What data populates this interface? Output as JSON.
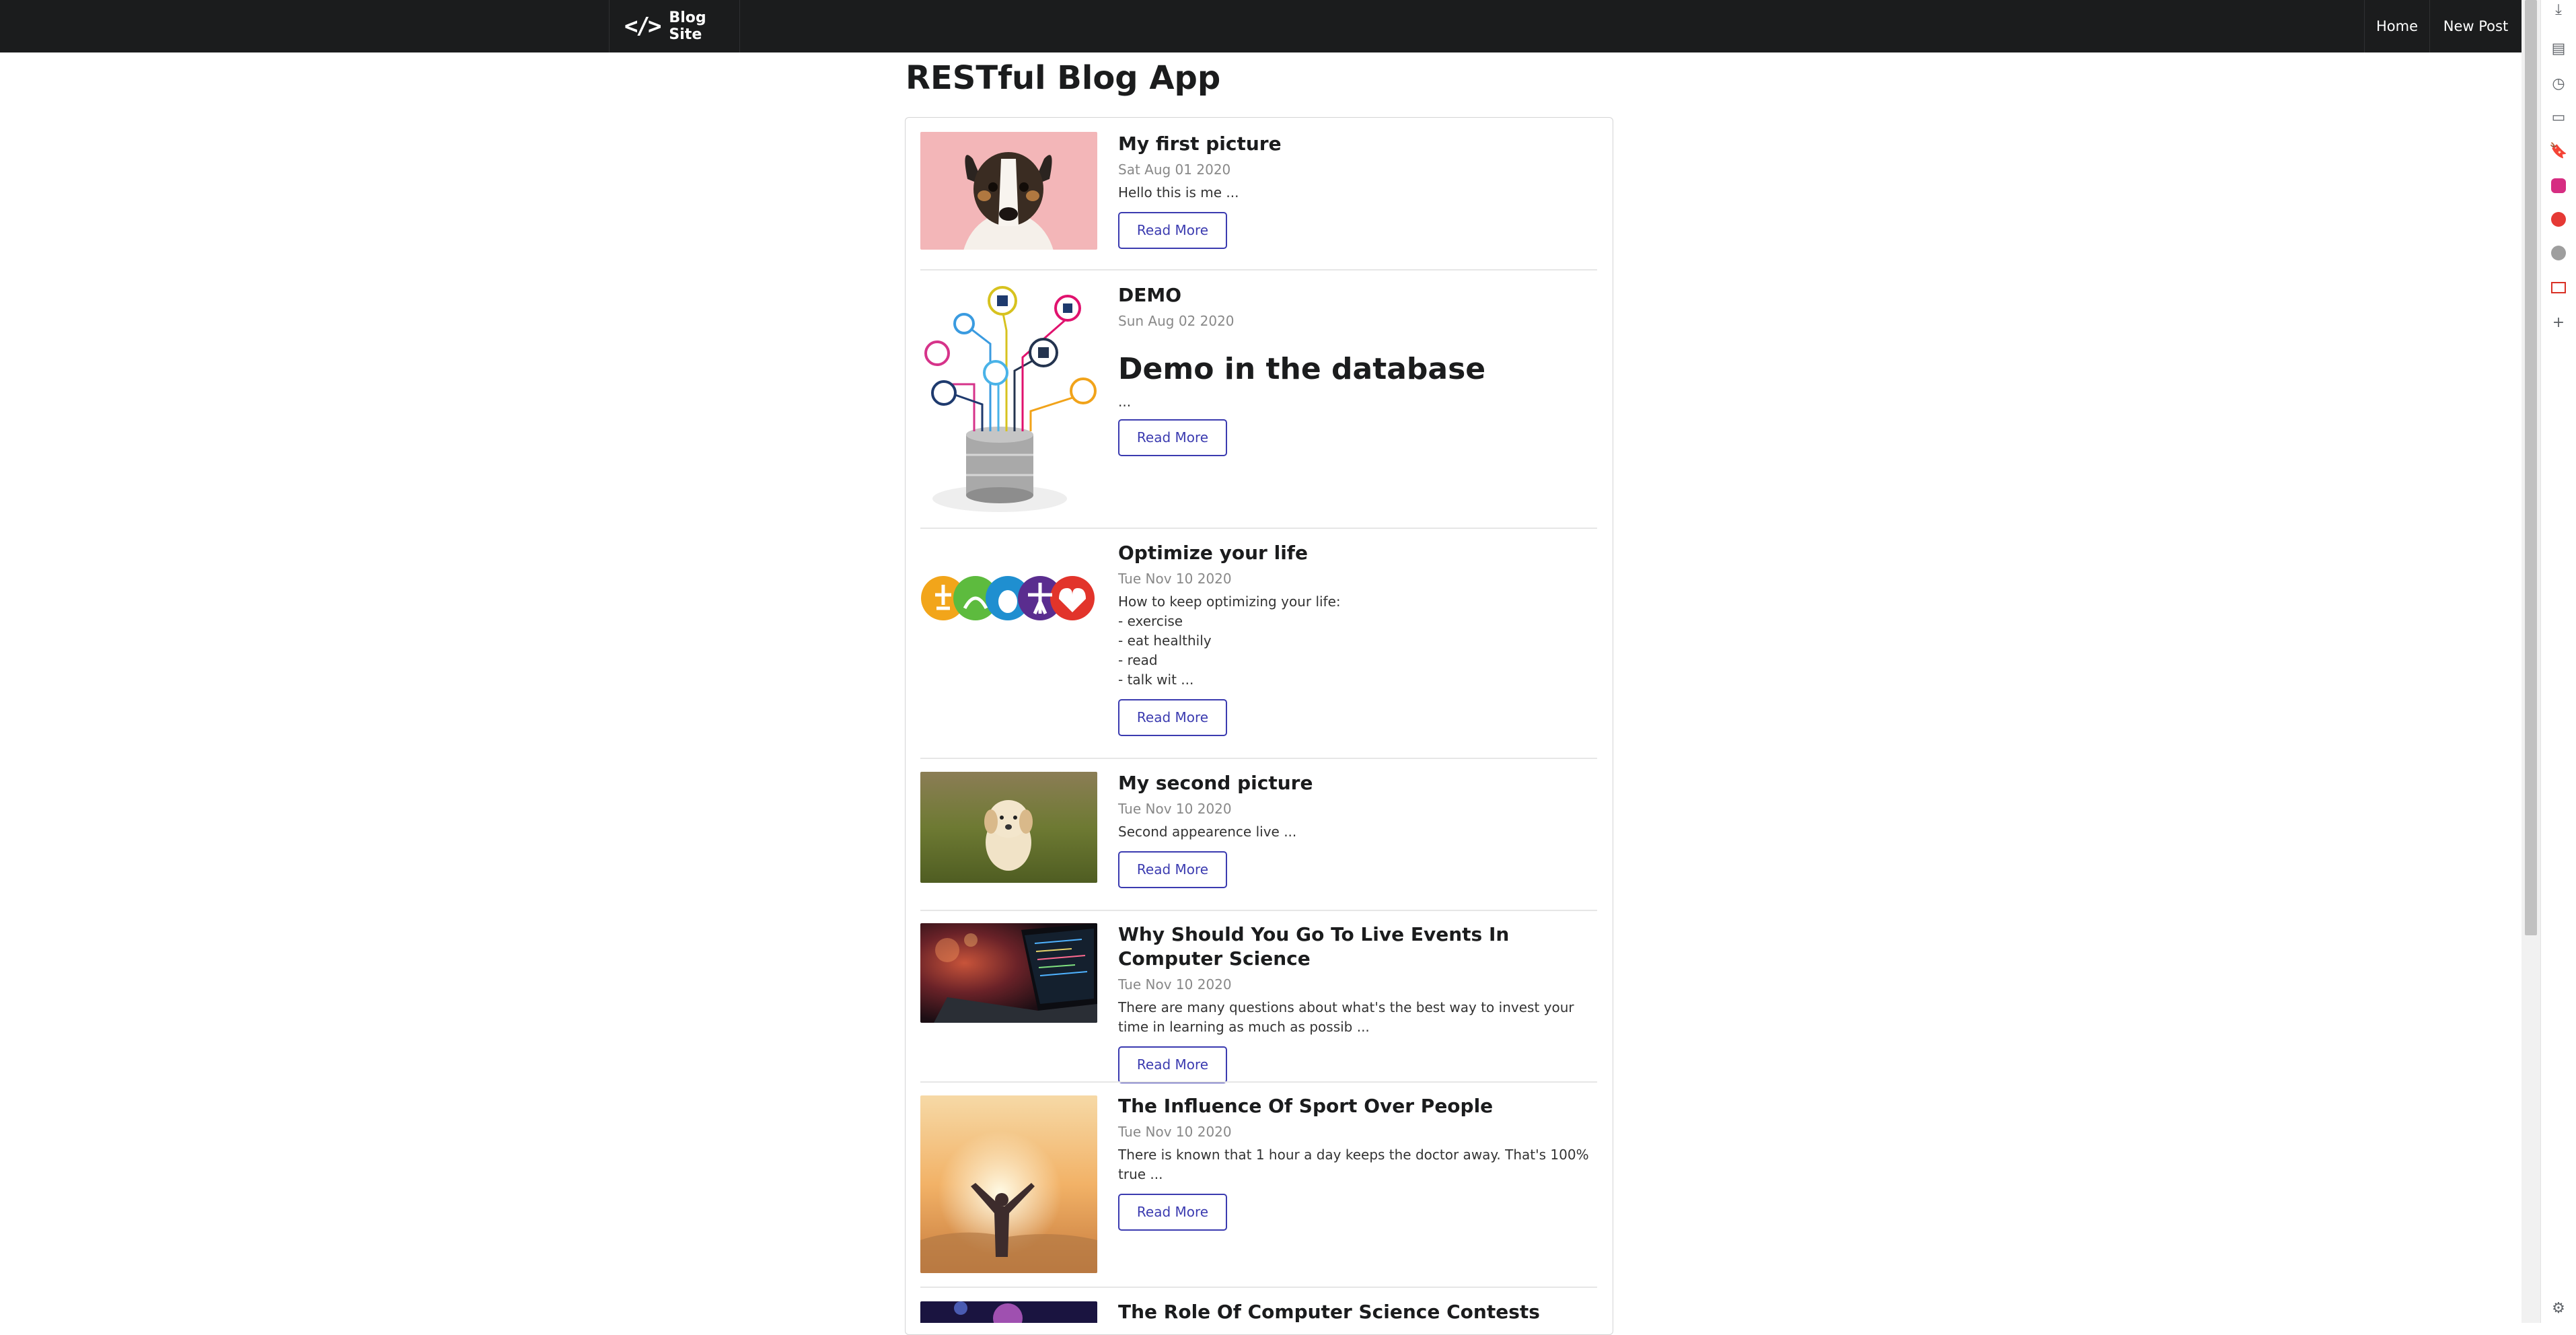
{
  "navbar": {
    "brand": "Blog Site",
    "brand_icon": "code-icon",
    "links": [
      {
        "label": "Home"
      },
      {
        "label": "New Post"
      }
    ]
  },
  "page": {
    "title": "RESTful Blog App"
  },
  "posts": [
    {
      "title": "My first picture",
      "date": "Sat Aug 01 2020",
      "description": "Hello this is me ...",
      "image": "dog-portrait-pink-background",
      "cta": "Read More"
    },
    {
      "title": "DEMO",
      "date": "Sun Aug 02 2020",
      "description": "Demo in the database",
      "description_tail": "...",
      "image": "database-infographic",
      "cta": "Read More"
    },
    {
      "title": "Optimize your life",
      "date": "Tue Nov 10 2020",
      "description": "How to keep optimizing your life:\n- exercise\n- eat healthily\n- read\n- talk wit ...",
      "image": "wellness-icons-row",
      "cta": "Read More"
    },
    {
      "title": "My second picture",
      "date": "Tue Nov 10 2020",
      "description": "Second appearence live ...",
      "image": "puppy-in-grass",
      "cta": "Read More"
    },
    {
      "title": "Why Should You Go To Live Events In Computer Science",
      "date": "Tue Nov 10 2020",
      "description": "There are many questions about what's the best way to invest your time in learning as much as possib ...",
      "image": "laptop-code-photo",
      "cta": "Read More"
    },
    {
      "title": "The Influence Of Sport Over People",
      "date": "Tue Nov 10 2020",
      "description": "There is known that 1 hour a day keeps the doctor away. That's 100% true ...",
      "image": "sunset-person-arms-raised",
      "cta": "Read More"
    },
    {
      "title": "The Role Of Computer Science Contests",
      "image": "contest-photo"
    }
  ],
  "browser_sidebar": {
    "icons": [
      "download-icon",
      "reading-list-icon",
      "history-icon",
      "tabs-icon",
      "bookmark-icon",
      "instagram-icon",
      "youtube-icon",
      "chrome-icon",
      "gmail-icon",
      "add-icon",
      "settings-icon"
    ]
  },
  "colors": {
    "navbar_bg": "#1b1c1d",
    "button_accent": "#3b3bb0",
    "date_text": "#888888"
  }
}
